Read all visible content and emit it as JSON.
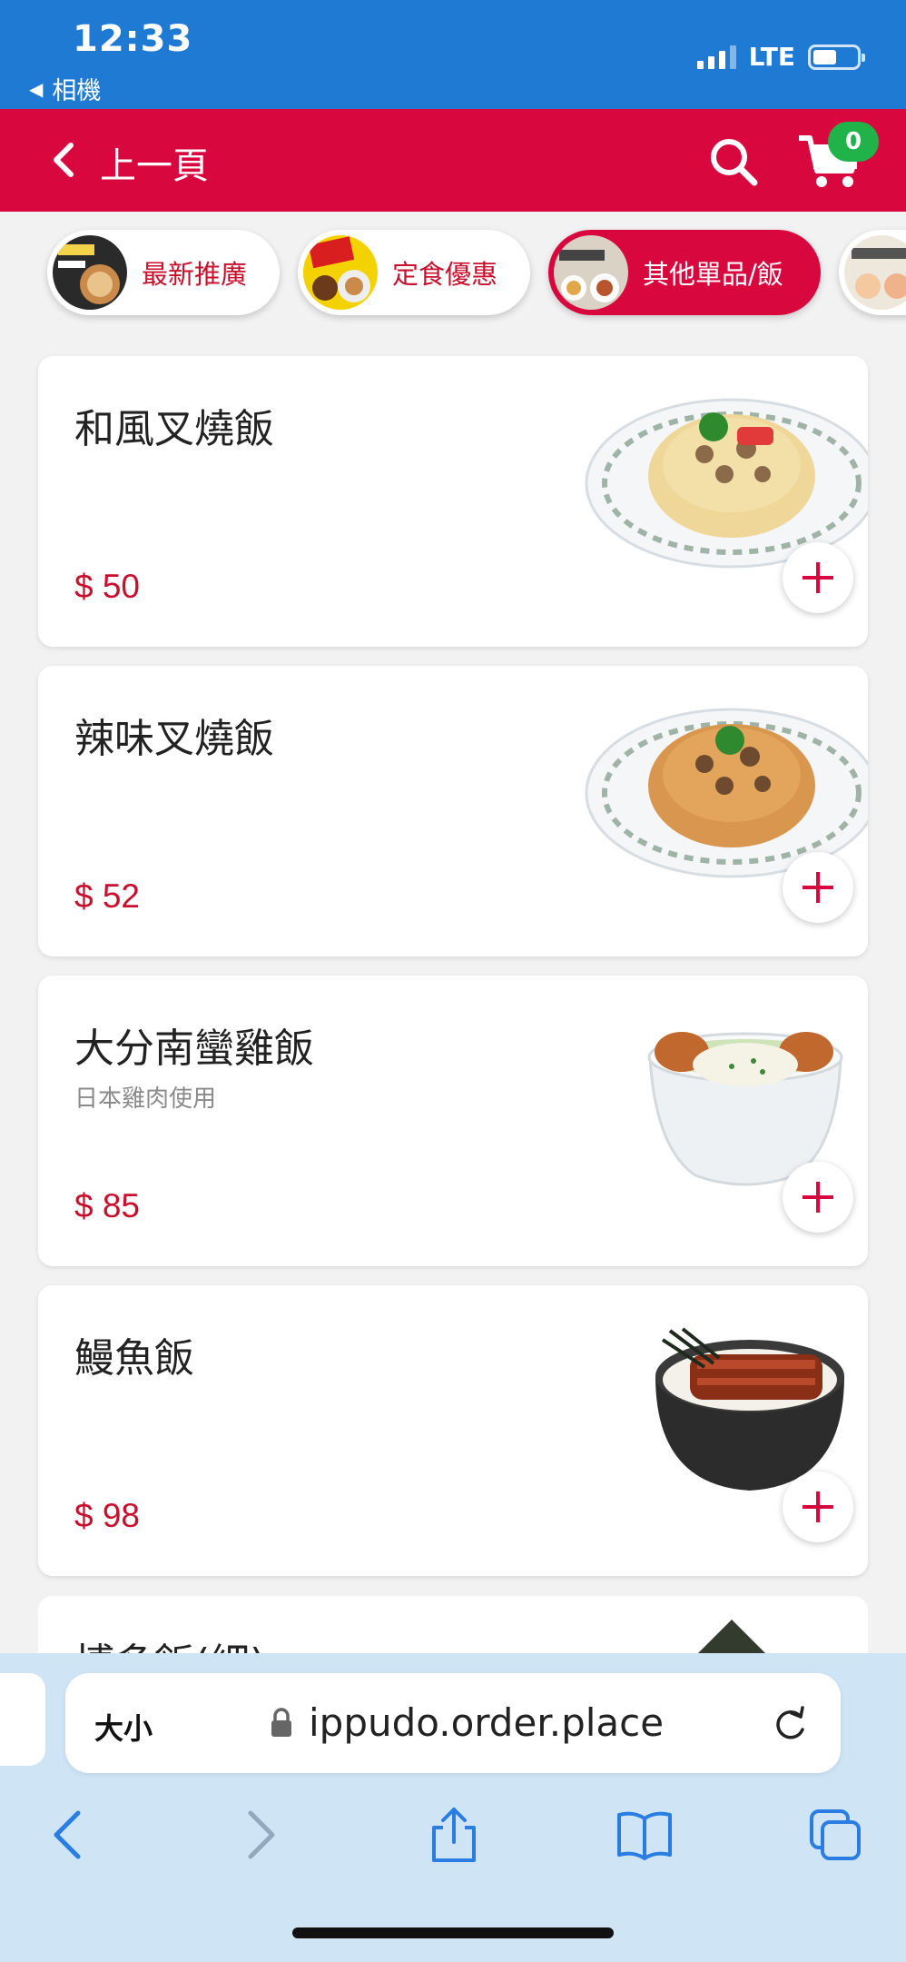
{
  "status_bar": {
    "time": "12:33",
    "back_app": "相機",
    "network": "LTE",
    "battery_level": 0.55
  },
  "header": {
    "back_label": "上一頁",
    "cart_count": "0",
    "bg_color": "#d8083e"
  },
  "categories": [
    {
      "label": "最新推廣",
      "icon": "promo-ramen-thumb",
      "active": false
    },
    {
      "label": "定食優惠",
      "icon": "set-meal-thumb",
      "active": false
    },
    {
      "label": "其他單品/飯",
      "icon": "a-la-carte-thumb",
      "active": true
    },
    {
      "label": "",
      "icon": "topping-thumb",
      "active": false
    }
  ],
  "menu_items": [
    {
      "name": "和風叉燒飯",
      "subtitle": "",
      "price": "$ 50",
      "image": "chashu-fried-rice"
    },
    {
      "name": "辣味叉燒飯",
      "subtitle": "",
      "price": "$ 52",
      "image": "spicy-chashu-fried-rice"
    },
    {
      "name": "大分南蠻雞飯",
      "subtitle": "日本雞肉使用",
      "price": "$ 85",
      "image": "nanban-chicken-rice"
    },
    {
      "name": "鰻魚飯",
      "subtitle": "",
      "price": "$ 98",
      "image": "unagi-rice"
    },
    {
      "name": "博多飯(細)",
      "subtitle": "",
      "price": "",
      "image": "hakata-rice"
    }
  ],
  "browser": {
    "text_size_label": "大小",
    "url": "ippudo.order.place"
  }
}
